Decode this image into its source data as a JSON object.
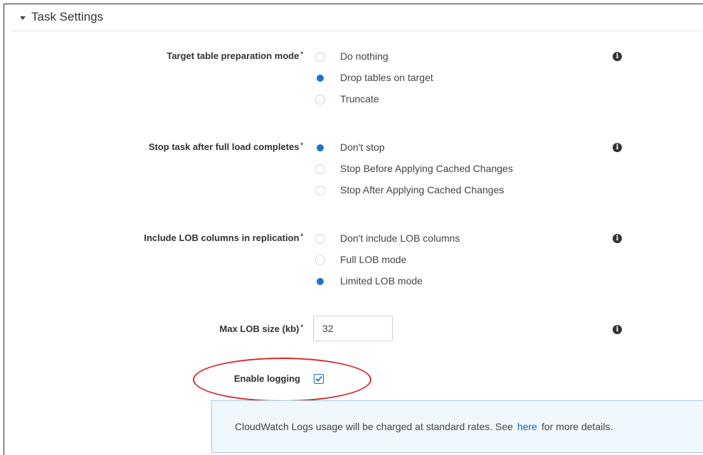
{
  "section": {
    "title": "Task Settings",
    "caret_icon": "caret-down-icon"
  },
  "prep_mode": {
    "label": "Target table preparation mode",
    "required_mark": "*",
    "options": [
      {
        "label": "Do nothing",
        "selected": false
      },
      {
        "label": "Drop tables on target",
        "selected": true
      },
      {
        "label": "Truncate",
        "selected": false
      }
    ],
    "info_icon": "info-icon"
  },
  "stop_task": {
    "label": "Stop task after full load completes",
    "required_mark": "*",
    "options": [
      {
        "label": "Don't stop",
        "selected": true
      },
      {
        "label": "Stop Before Applying Cached Changes",
        "selected": false
      },
      {
        "label": "Stop After Applying Cached Changes",
        "selected": false
      }
    ],
    "info_icon": "info-icon"
  },
  "lob_columns": {
    "label": "Include LOB columns in replication",
    "required_mark": "*",
    "options": [
      {
        "label": "Don't include LOB columns",
        "selected": false
      },
      {
        "label": "Full LOB mode",
        "selected": false
      },
      {
        "label": "Limited LOB mode",
        "selected": true
      }
    ],
    "info_icon": "info-icon"
  },
  "max_lob": {
    "label": "Max LOB size (kb)",
    "required_mark": "*",
    "value": "32",
    "info_icon": "info-icon"
  },
  "logging": {
    "label": "Enable logging",
    "checked": true
  },
  "alert": {
    "text_before": "CloudWatch Logs usage will be charged at standard rates. See",
    "link_text": "here",
    "text_after": "for more details."
  },
  "colors": {
    "accent": "#1e73c9",
    "annotation": "#d42a2a",
    "alert_bg": "#f0f7fd",
    "link": "#1166bb"
  }
}
